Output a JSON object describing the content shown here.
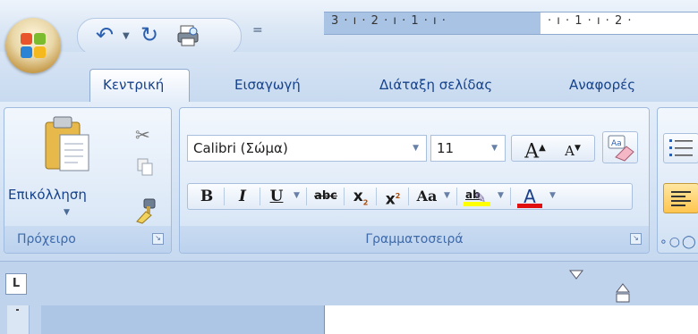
{
  "tabs": [
    {
      "label": "Κεντρική",
      "active": true
    },
    {
      "label": "Εισαγωγή",
      "active": false
    },
    {
      "label": "Διάταξη σελίδας",
      "active": false
    },
    {
      "label": "Αναφορές",
      "active": false
    }
  ],
  "quick_access": {
    "undo_icon": "undo-icon",
    "redo_icon": "redo-icon",
    "print_icon": "print-preview-icon",
    "customize_glyph": "="
  },
  "clipboard": {
    "paste_label": "Επικόλληση",
    "group_label": "Πρόχειρο"
  },
  "font": {
    "family": "Calibri (Σώμα)",
    "size": "11",
    "grow_glyph": "A",
    "shrink_glyph": "A",
    "bold": "B",
    "italic": "I",
    "underline": "U",
    "strike": "abc",
    "subscript": "x",
    "superscript": "x",
    "change_case": "Aa",
    "highlight": "ab",
    "font_color": "A",
    "group_label": "Γραμματοσειρά"
  },
  "ruler": {
    "left_ticks": "3 · ı · 2 · ı · 1 · ı ·",
    "right_ticks": "· ı · 1 · ı · 2 ·",
    "tab_selector": "L"
  },
  "colors": {
    "accent": "#15428b",
    "highlight_yellow": "#ffff00",
    "font_color_red": "#e01010"
  }
}
